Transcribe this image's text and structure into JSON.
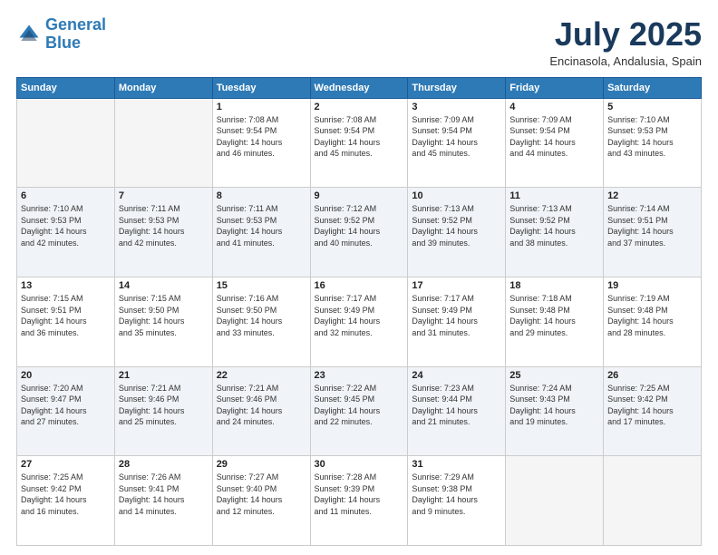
{
  "header": {
    "logo_line1": "General",
    "logo_line2": "Blue",
    "month_year": "July 2025",
    "location": "Encinasola, Andalusia, Spain"
  },
  "days_of_week": [
    "Sunday",
    "Monday",
    "Tuesday",
    "Wednesday",
    "Thursday",
    "Friday",
    "Saturday"
  ],
  "weeks": [
    [
      {
        "day": "",
        "info": ""
      },
      {
        "day": "",
        "info": ""
      },
      {
        "day": "1",
        "info": "Sunrise: 7:08 AM\nSunset: 9:54 PM\nDaylight: 14 hours\nand 46 minutes."
      },
      {
        "day": "2",
        "info": "Sunrise: 7:08 AM\nSunset: 9:54 PM\nDaylight: 14 hours\nand 45 minutes."
      },
      {
        "day": "3",
        "info": "Sunrise: 7:09 AM\nSunset: 9:54 PM\nDaylight: 14 hours\nand 45 minutes."
      },
      {
        "day": "4",
        "info": "Sunrise: 7:09 AM\nSunset: 9:54 PM\nDaylight: 14 hours\nand 44 minutes."
      },
      {
        "day": "5",
        "info": "Sunrise: 7:10 AM\nSunset: 9:53 PM\nDaylight: 14 hours\nand 43 minutes."
      }
    ],
    [
      {
        "day": "6",
        "info": "Sunrise: 7:10 AM\nSunset: 9:53 PM\nDaylight: 14 hours\nand 42 minutes."
      },
      {
        "day": "7",
        "info": "Sunrise: 7:11 AM\nSunset: 9:53 PM\nDaylight: 14 hours\nand 42 minutes."
      },
      {
        "day": "8",
        "info": "Sunrise: 7:11 AM\nSunset: 9:53 PM\nDaylight: 14 hours\nand 41 minutes."
      },
      {
        "day": "9",
        "info": "Sunrise: 7:12 AM\nSunset: 9:52 PM\nDaylight: 14 hours\nand 40 minutes."
      },
      {
        "day": "10",
        "info": "Sunrise: 7:13 AM\nSunset: 9:52 PM\nDaylight: 14 hours\nand 39 minutes."
      },
      {
        "day": "11",
        "info": "Sunrise: 7:13 AM\nSunset: 9:52 PM\nDaylight: 14 hours\nand 38 minutes."
      },
      {
        "day": "12",
        "info": "Sunrise: 7:14 AM\nSunset: 9:51 PM\nDaylight: 14 hours\nand 37 minutes."
      }
    ],
    [
      {
        "day": "13",
        "info": "Sunrise: 7:15 AM\nSunset: 9:51 PM\nDaylight: 14 hours\nand 36 minutes."
      },
      {
        "day": "14",
        "info": "Sunrise: 7:15 AM\nSunset: 9:50 PM\nDaylight: 14 hours\nand 35 minutes."
      },
      {
        "day": "15",
        "info": "Sunrise: 7:16 AM\nSunset: 9:50 PM\nDaylight: 14 hours\nand 33 minutes."
      },
      {
        "day": "16",
        "info": "Sunrise: 7:17 AM\nSunset: 9:49 PM\nDaylight: 14 hours\nand 32 minutes."
      },
      {
        "day": "17",
        "info": "Sunrise: 7:17 AM\nSunset: 9:49 PM\nDaylight: 14 hours\nand 31 minutes."
      },
      {
        "day": "18",
        "info": "Sunrise: 7:18 AM\nSunset: 9:48 PM\nDaylight: 14 hours\nand 29 minutes."
      },
      {
        "day": "19",
        "info": "Sunrise: 7:19 AM\nSunset: 9:48 PM\nDaylight: 14 hours\nand 28 minutes."
      }
    ],
    [
      {
        "day": "20",
        "info": "Sunrise: 7:20 AM\nSunset: 9:47 PM\nDaylight: 14 hours\nand 27 minutes."
      },
      {
        "day": "21",
        "info": "Sunrise: 7:21 AM\nSunset: 9:46 PM\nDaylight: 14 hours\nand 25 minutes."
      },
      {
        "day": "22",
        "info": "Sunrise: 7:21 AM\nSunset: 9:46 PM\nDaylight: 14 hours\nand 24 minutes."
      },
      {
        "day": "23",
        "info": "Sunrise: 7:22 AM\nSunset: 9:45 PM\nDaylight: 14 hours\nand 22 minutes."
      },
      {
        "day": "24",
        "info": "Sunrise: 7:23 AM\nSunset: 9:44 PM\nDaylight: 14 hours\nand 21 minutes."
      },
      {
        "day": "25",
        "info": "Sunrise: 7:24 AM\nSunset: 9:43 PM\nDaylight: 14 hours\nand 19 minutes."
      },
      {
        "day": "26",
        "info": "Sunrise: 7:25 AM\nSunset: 9:42 PM\nDaylight: 14 hours\nand 17 minutes."
      }
    ],
    [
      {
        "day": "27",
        "info": "Sunrise: 7:25 AM\nSunset: 9:42 PM\nDaylight: 14 hours\nand 16 minutes."
      },
      {
        "day": "28",
        "info": "Sunrise: 7:26 AM\nSunset: 9:41 PM\nDaylight: 14 hours\nand 14 minutes."
      },
      {
        "day": "29",
        "info": "Sunrise: 7:27 AM\nSunset: 9:40 PM\nDaylight: 14 hours\nand 12 minutes."
      },
      {
        "day": "30",
        "info": "Sunrise: 7:28 AM\nSunset: 9:39 PM\nDaylight: 14 hours\nand 11 minutes."
      },
      {
        "day": "31",
        "info": "Sunrise: 7:29 AM\nSunset: 9:38 PM\nDaylight: 14 hours\nand 9 minutes."
      },
      {
        "day": "",
        "info": ""
      },
      {
        "day": "",
        "info": ""
      }
    ]
  ]
}
